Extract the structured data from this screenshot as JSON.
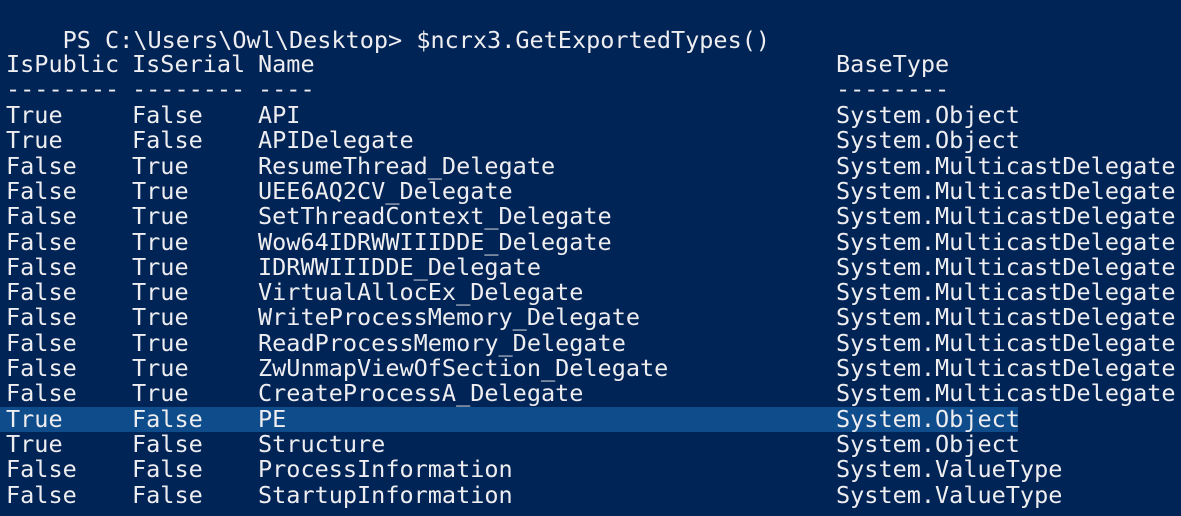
{
  "console": {
    "prompt": "PS C:\\Users\\Owl\\Desktop>",
    "command": "$ncrx3.GetExportedTypes()",
    "headers": [
      "IsPublic",
      "IsSerial",
      "Name",
      "BaseType"
    ],
    "separators": [
      "--------",
      "--------",
      "----",
      "--------"
    ],
    "rows": [
      [
        "True",
        "False",
        "API",
        "System.Object"
      ],
      [
        "True",
        "False",
        "APIDelegate",
        "System.Object"
      ],
      [
        "False",
        "True",
        "ResumeThread_Delegate",
        "System.MulticastDelegate"
      ],
      [
        "False",
        "True",
        "UEE6AQ2CV_Delegate",
        "System.MulticastDelegate"
      ],
      [
        "False",
        "True",
        "SetThreadContext_Delegate",
        "System.MulticastDelegate"
      ],
      [
        "False",
        "True",
        "Wow64IDRWWIIIDDE_Delegate",
        "System.MulticastDelegate"
      ],
      [
        "False",
        "True",
        "IDRWWIIIDDE_Delegate",
        "System.MulticastDelegate"
      ],
      [
        "False",
        "True",
        "VirtualAllocEx_Delegate",
        "System.MulticastDelegate"
      ],
      [
        "False",
        "True",
        "WriteProcessMemory_Delegate",
        "System.MulticastDelegate"
      ],
      [
        "False",
        "True",
        "ReadProcessMemory_Delegate",
        "System.MulticastDelegate"
      ],
      [
        "False",
        "True",
        "ZwUnmapViewOfSection_Delegate",
        "System.MulticastDelegate"
      ],
      [
        "False",
        "True",
        "CreateProcessA_Delegate",
        "System.MulticastDelegate"
      ],
      [
        "True",
        "False",
        "PE",
        "System.Object"
      ],
      [
        "True",
        "False",
        "Structure",
        "System.Object"
      ],
      [
        "False",
        "False",
        "ProcessInformation",
        "System.ValueType"
      ],
      [
        "False",
        "False",
        "StartupInformation",
        "System.ValueType"
      ]
    ],
    "highlighted_row": 12,
    "colors": {
      "background": "#012456",
      "foreground": "#eeedf0",
      "selection": "#0f4c8b"
    }
  }
}
